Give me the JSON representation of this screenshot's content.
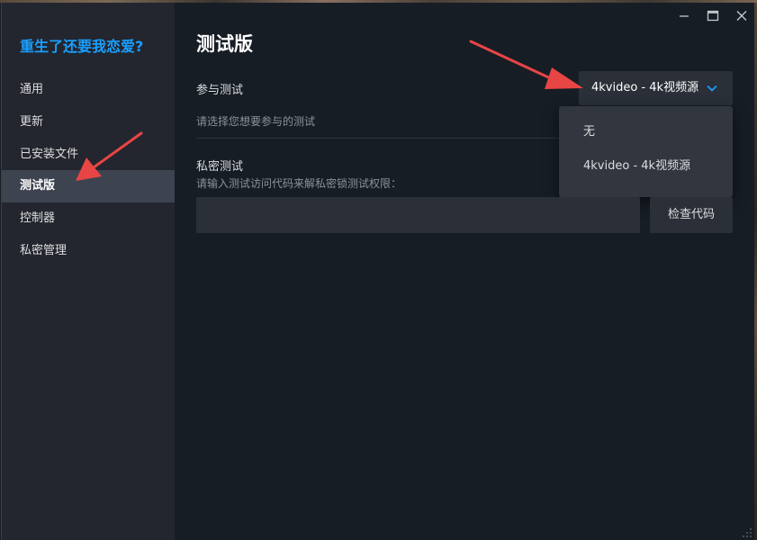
{
  "window": {
    "minimize_icon": "minimize-icon",
    "maximize_icon": "maximize-icon",
    "close_icon": "close-icon"
  },
  "sidebar": {
    "game_title": "重生了还要我恋爱?",
    "items": [
      {
        "label": "通用"
      },
      {
        "label": "更新"
      },
      {
        "label": "已安装文件"
      },
      {
        "label": "测试版",
        "active": true
      },
      {
        "label": "控制器"
      },
      {
        "label": "私密管理"
      }
    ]
  },
  "main": {
    "title": "测试版",
    "participate": {
      "label": "参与测试",
      "hint": "请选择您想要参与的测试",
      "selected": "4kvideo - 4k视频源",
      "options": [
        "无",
        "4kvideo - 4k视频源"
      ]
    },
    "private": {
      "label": "私密测试",
      "hint": "请输入测试访问代码来解私密锁测试权限：",
      "input_value": "",
      "check_button": "检查代码"
    }
  },
  "colors": {
    "accent": "#1a9fff",
    "annotation_arrow": "#e84545",
    "sidebar_bg": "#23262e",
    "main_bg": "#171d25"
  }
}
